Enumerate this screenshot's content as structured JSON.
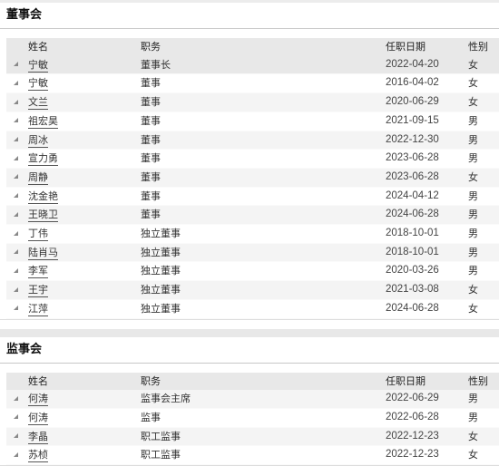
{
  "board": {
    "title": "董事会",
    "columns": {
      "name": "姓名",
      "role": "职务",
      "date": "任职日期",
      "gender": "性别"
    },
    "rows": [
      {
        "name": "宁敏",
        "role": "董事长",
        "date": "2022-04-20",
        "gender": "女"
      },
      {
        "name": "宁敏",
        "role": "董事",
        "date": "2016-04-02",
        "gender": "女"
      },
      {
        "name": "文兰",
        "role": "董事",
        "date": "2020-06-29",
        "gender": "女"
      },
      {
        "name": "祖宏昊",
        "role": "董事",
        "date": "2021-09-15",
        "gender": "男"
      },
      {
        "name": "周冰",
        "role": "董事",
        "date": "2022-12-30",
        "gender": "男"
      },
      {
        "name": "宣力勇",
        "role": "董事",
        "date": "2023-06-28",
        "gender": "男"
      },
      {
        "name": "周静",
        "role": "董事",
        "date": "2023-06-28",
        "gender": "女"
      },
      {
        "name": "沈金艳",
        "role": "董事",
        "date": "2024-04-12",
        "gender": "男"
      },
      {
        "name": "王晓卫",
        "role": "董事",
        "date": "2024-06-28",
        "gender": "男"
      },
      {
        "name": "丁伟",
        "role": "独立董事",
        "date": "2018-10-01",
        "gender": "男"
      },
      {
        "name": "陆肖马",
        "role": "独立董事",
        "date": "2018-10-01",
        "gender": "男"
      },
      {
        "name": "李军",
        "role": "独立董事",
        "date": "2020-03-26",
        "gender": "男"
      },
      {
        "name": "王宇",
        "role": "独立董事",
        "date": "2021-03-08",
        "gender": "女"
      },
      {
        "name": "江萍",
        "role": "独立董事",
        "date": "2024-06-28",
        "gender": "女"
      }
    ]
  },
  "supervisors": {
    "title": "监事会",
    "columns": {
      "name": "姓名",
      "role": "职务",
      "date": "任职日期",
      "gender": "性别"
    },
    "rows": [
      {
        "name": "何涛",
        "role": "监事会主席",
        "date": "2022-06-29",
        "gender": "男"
      },
      {
        "name": "何涛",
        "role": "监事",
        "date": "2022-06-28",
        "gender": "男"
      },
      {
        "name": "李晶",
        "role": "职工监事",
        "date": "2022-12-23",
        "gender": "女"
      },
      {
        "name": "苏桢",
        "role": "职工监事",
        "date": "2022-12-23",
        "gender": "女"
      }
    ]
  }
}
